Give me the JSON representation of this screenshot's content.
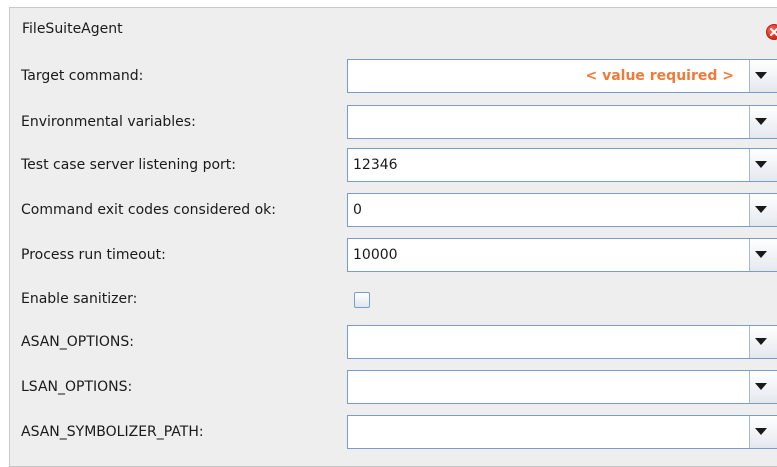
{
  "window": {
    "title": "FileSuiteAgent"
  },
  "fields": [
    {
      "label": "Target command:",
      "value": "",
      "warning": "< value required >"
    },
    {
      "label": "Environmental variables:",
      "value": ""
    },
    {
      "label": "Test case server listening port:",
      "value": "12346"
    },
    {
      "label": "Command exit codes considered ok:",
      "value": "0"
    },
    {
      "label": "Process run timeout:",
      "value": "10000"
    },
    {
      "label": "Enable sanitizer:",
      "checked": false
    },
    {
      "label": "ASAN_OPTIONS:",
      "value": ""
    },
    {
      "label": "LSAN_OPTIONS:",
      "value": ""
    },
    {
      "label": "ASAN_SYMBOLIZER_PATH:",
      "value": ""
    }
  ],
  "icons": {
    "close": "close-circle-icon",
    "dropdown": "triangle-down-icon"
  },
  "colors": {
    "panel_bg": "#eeeeee",
    "field_border": "#7a9cc6",
    "warning_text": "#f07a3a",
    "close_red": "#d2271b"
  }
}
